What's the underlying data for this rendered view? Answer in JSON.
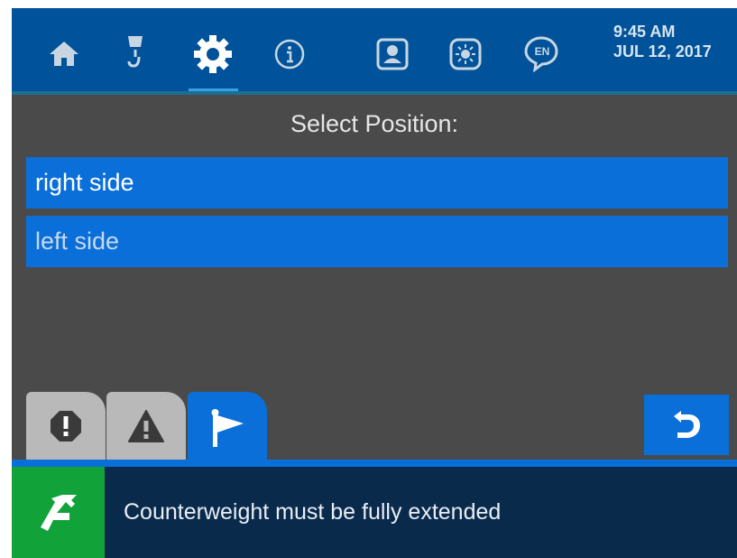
{
  "header": {
    "nav_icons": [
      "home-icon",
      "crane-hook-icon",
      "gear-icon",
      "info-icon",
      "operator-icon",
      "brightness-icon",
      "language-icon"
    ],
    "language_badge": "EN",
    "time": "9:45 AM",
    "date": "JUL 12, 2017"
  },
  "main": {
    "title": "Select Position:",
    "options": [
      "right side",
      "left side"
    ]
  },
  "tabs": {
    "items": [
      "error-icon",
      "warning-icon",
      "flag-icon"
    ],
    "active": "flag-icon"
  },
  "back_button": {
    "icon": "back-arrow-icon"
  },
  "status": {
    "icon": "turn-arrow-icon",
    "message": "Counterweight must be fully extended"
  },
  "colors": {
    "header_bg": "#00539a",
    "body_bg": "#4a4a4a",
    "accent_blue": "#0a6fd8",
    "status_bar": "#0a2a4c",
    "status_icon_bg": "#11a33a"
  }
}
